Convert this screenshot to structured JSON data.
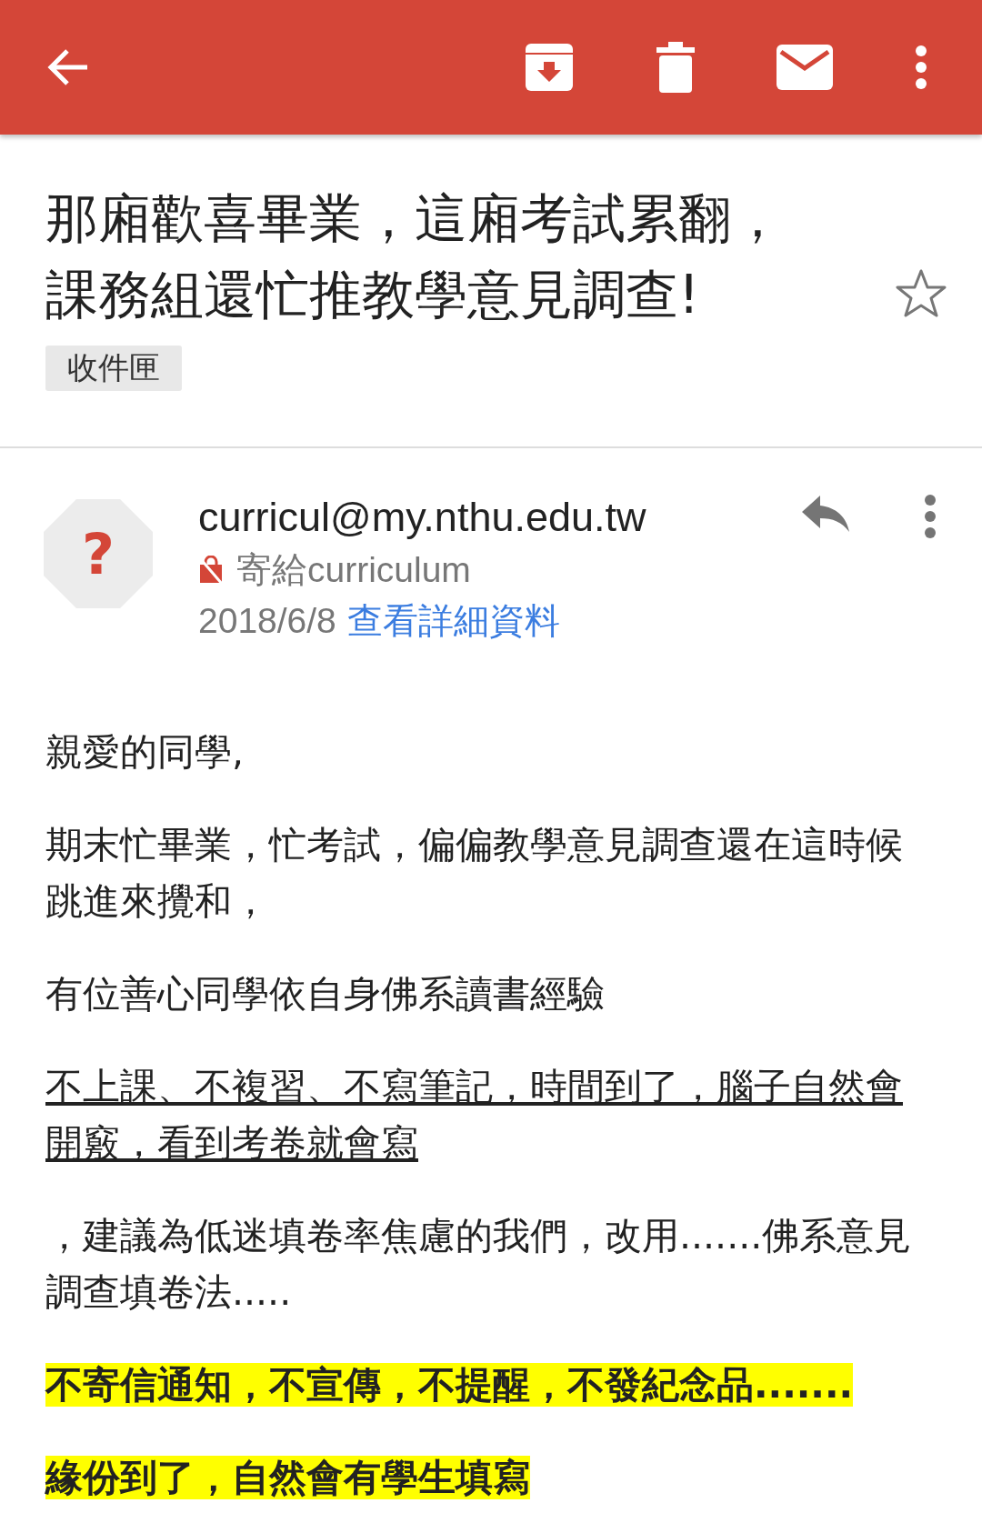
{
  "subject": {
    "title": "那廂歡喜畢業，這廂考試累翻，課務組還忙推教學意見調查!",
    "starred": false,
    "label": "收件匣"
  },
  "sender": {
    "avatar": "?",
    "address": "curricul@my.nthu.edu.tw",
    "recipient": "寄給curriculum",
    "date": "2018/6/8",
    "details_link": "查看詳細資料"
  },
  "body": [
    {
      "kind": "plain",
      "text": "親愛的同學,"
    },
    {
      "kind": "plain",
      "text": "期末忙畢業，忙考試，偏偏教學意見調查還在這時候跳進來攪和，"
    },
    {
      "kind": "plain",
      "text": "有位善心同學依自身佛系讀書經驗"
    },
    {
      "kind": "underline",
      "text": "不上課、不複習、不寫筆記，時間到了，腦子自然會開竅，看到考卷就會寫"
    },
    {
      "kind": "plain",
      "text": "，建議為低迷填卷率焦慮的我們，改用.......佛系意見調查填卷法....."
    },
    {
      "kind": "highlight",
      "text": "不寄信通知，不宣傳，不提醒，不發紀念品......."
    },
    {
      "kind": "highlight",
      "text": "緣份到了，自然會有學生填寫"
    }
  ]
}
